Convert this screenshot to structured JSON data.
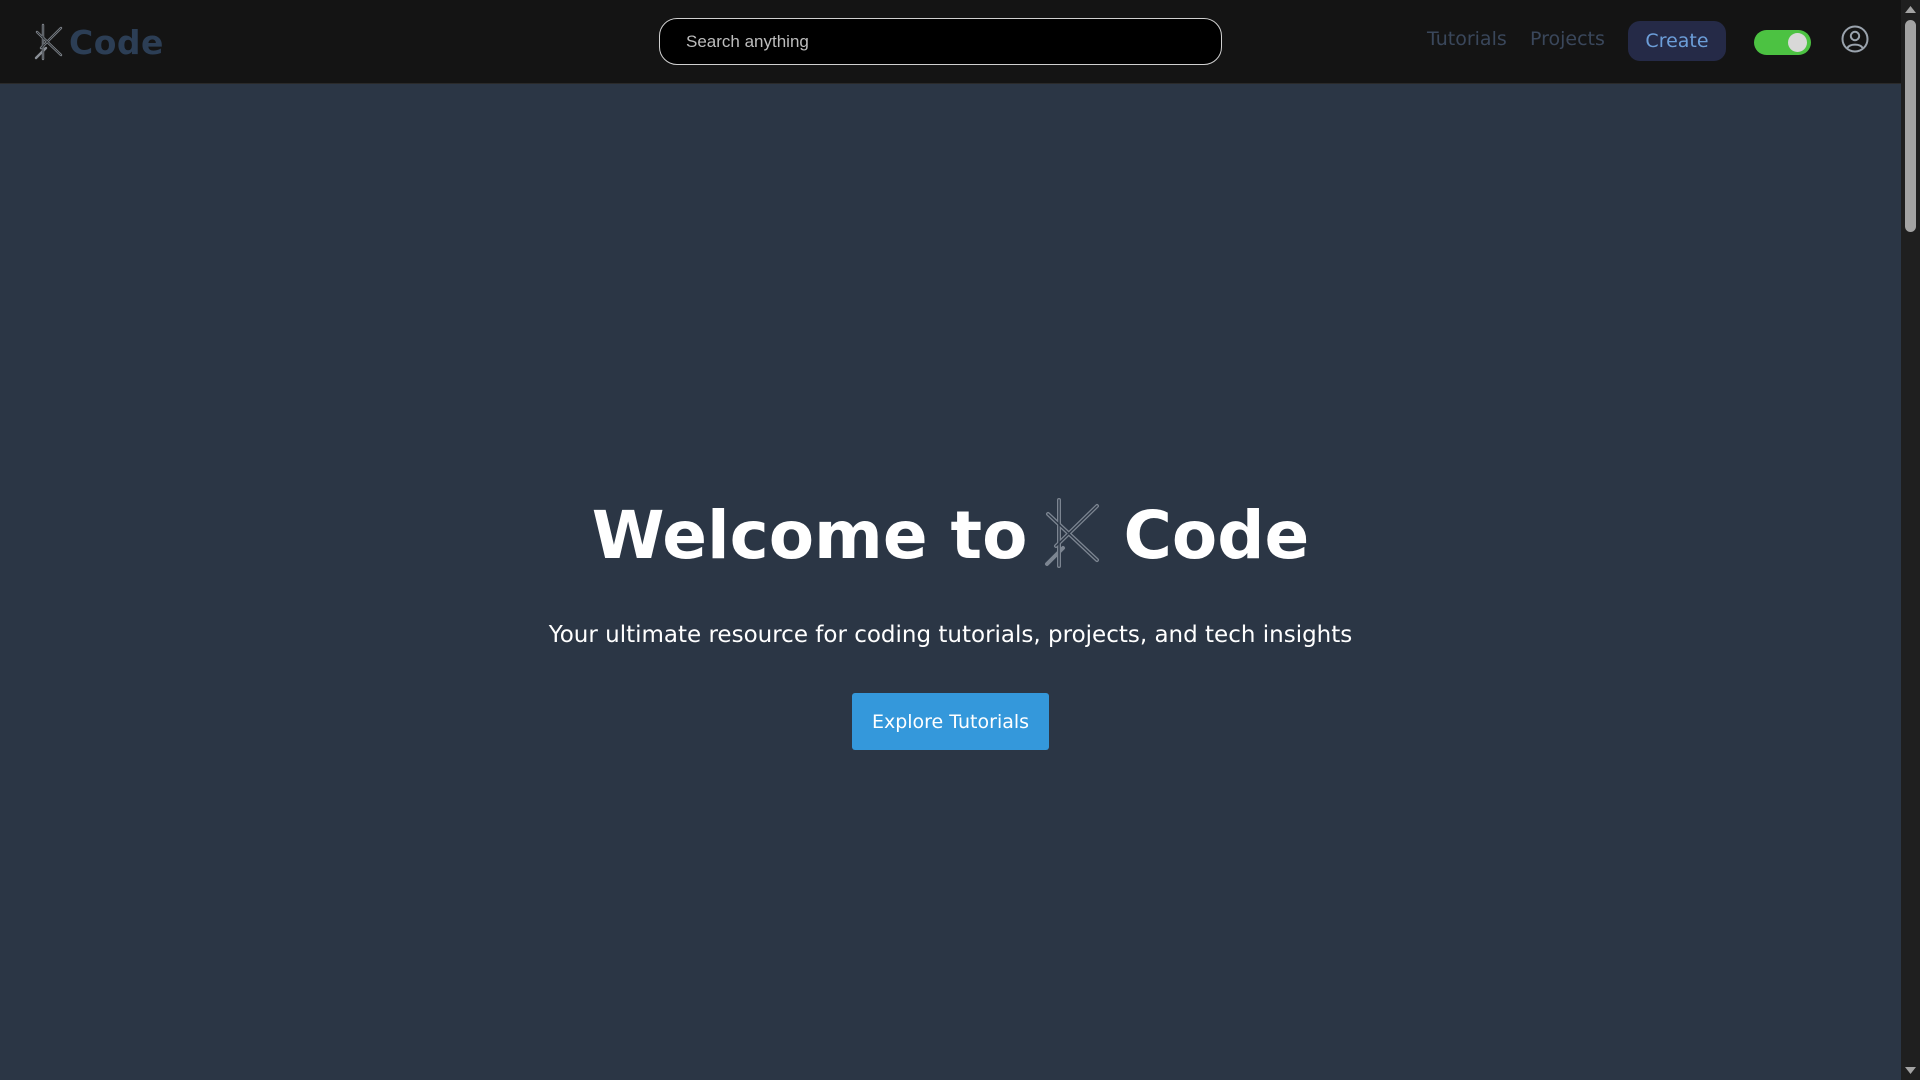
{
  "header": {
    "brand_name": "Code",
    "search": {
      "placeholder": "Search anything",
      "value": ""
    },
    "nav": {
      "tutorials_label": "Tutorials",
      "projects_label": "Projects"
    },
    "create_label": "Create",
    "toggle": {
      "state": "on",
      "color": "#4cc242"
    },
    "user_icon": "user-circle-icon"
  },
  "hero": {
    "title_prefix": "Welcome to",
    "title_suffix": "Code",
    "subtitle": "Your ultimate resource for coding tutorials, projects, and tech insights",
    "cta_label": "Explore Tutorials"
  },
  "colors": {
    "header_bg": "#141414",
    "page_bg": "#2b3645",
    "accent": "#3498db",
    "create_bg": "#252a47"
  }
}
